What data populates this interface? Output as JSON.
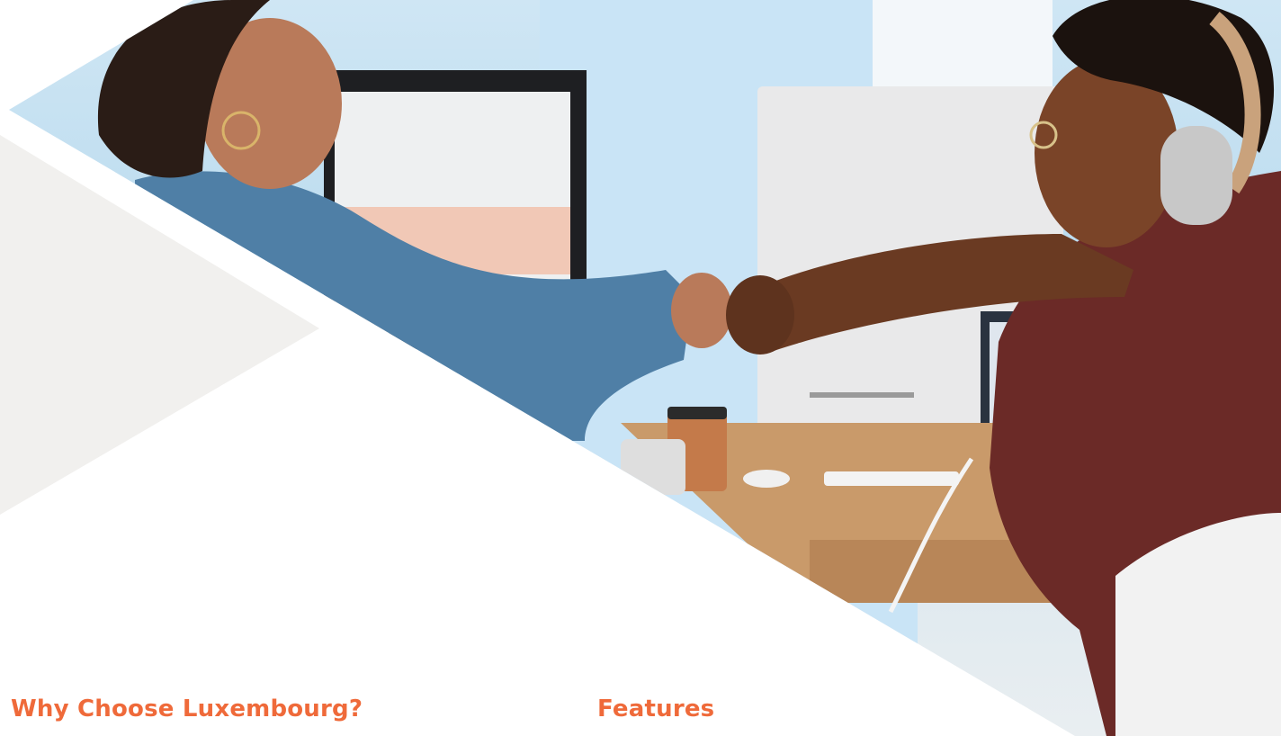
{
  "hero": {
    "image_alt": "Two coworkers fist bumping at their desks in an office",
    "colors": {
      "sky": "#cfe6f4",
      "denim": "#4f7fa6",
      "shirt": "#6b2a27",
      "skin_light": "#b97a5a",
      "skin_dark": "#6a3a22",
      "desk": "#c99a6a",
      "monitor": "#e9e9ea"
    }
  },
  "sections": {
    "left_heading": "Why Choose Luxembourg?",
    "right_heading": "Features"
  },
  "theme": {
    "accent": "#ef6a3a",
    "panel_grey": "#f1f0ee",
    "background": "#ffffff"
  }
}
